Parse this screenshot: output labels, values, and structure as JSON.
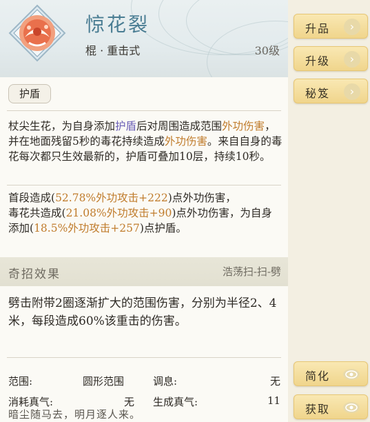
{
  "skill": {
    "name": "惊花裂",
    "type": "棍 · 重击式",
    "level": "30级",
    "tag": "护盾"
  },
  "description": {
    "p1": "杖尖生花，为自身添加",
    "shield": "护盾",
    "p2": "后对周围造成范围",
    "dmg1": "外功伤害",
    "p3": "，并在地面残留5秒的毒花持续造成",
    "dmg2": "外功伤害",
    "p4": "。来自自身的毒花每次都只生效最新的，护盾可叠加10层，持续10秒。"
  },
  "detail": {
    "l1a": "首段造成(",
    "l1b": "52.78%外功攻击+222",
    "l1c": ")点外功伤害，",
    "l2a": "毒花共造成(",
    "l2b": "21.08%外功攻击+90",
    "l2c": ")点外功伤害，为自身添加(",
    "l2d": "18.5%外功攻击+257",
    "l2e": ")点护盾。"
  },
  "qizhao": {
    "title": "奇招效果",
    "name": "浩荡扫-扫-劈",
    "text": "劈击附带2圈逐渐扩大的范围伤害，分别为半径2、4米，每段造成60%该重击的伤害。"
  },
  "stats": {
    "range_label": "范围:",
    "range_value": "圆形范围",
    "tiaoxi_label": "调息:",
    "tiaoxi_value": "无",
    "cost_label": "消耗真气:",
    "cost_value": "无",
    "gain_label": "生成真气:",
    "gain_value": "11"
  },
  "quote": "暗尘随马去，明月逐人来。",
  "buttons": {
    "upgrade_quality": "升品",
    "upgrade_level": "升级",
    "secret": "秘笈",
    "simplify": "简化",
    "obtain": "获取"
  },
  "colors": {
    "name": "#4a7d93",
    "shield": "#6b5fb6",
    "damage": "#c07c2c",
    "button": "#f0d58c"
  }
}
